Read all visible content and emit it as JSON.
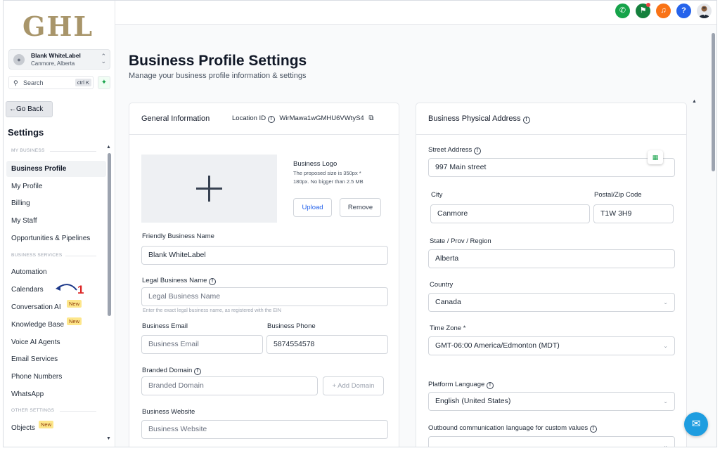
{
  "brand": {
    "logo_text": "GHL",
    "logo_color": "#a8956a"
  },
  "account": {
    "name": "Blank WhiteLabel",
    "location": "Canmore, Alberta"
  },
  "search": {
    "label": "Search",
    "shortcut": "ctrl K"
  },
  "sidebar": {
    "go_back": "Go Back",
    "title": "Settings",
    "sections": [
      {
        "label": "MY BUSINESS"
      },
      {
        "label": "BUSINESS SERVICES"
      },
      {
        "label": "OTHER SETTINGS"
      }
    ],
    "items": [
      {
        "label": "Business Profile",
        "active": true
      },
      {
        "label": "My Profile"
      },
      {
        "label": "Billing"
      },
      {
        "label": "My Staff"
      },
      {
        "label": "Opportunities & Pipelines"
      },
      {
        "label": "Automation"
      },
      {
        "label": "Calendars"
      },
      {
        "label": "Conversation AI",
        "badge": "New"
      },
      {
        "label": "Knowledge Base",
        "badge": "New"
      },
      {
        "label": "Voice AI Agents"
      },
      {
        "label": "Email Services"
      },
      {
        "label": "Phone Numbers"
      },
      {
        "label": "WhatsApp"
      },
      {
        "label": "Objects",
        "badge": "New"
      }
    ],
    "annotation_number": "1"
  },
  "topbar": {
    "icons": [
      "phone-icon",
      "megaphone-icon",
      "bell-icon",
      "help-icon",
      "user-avatar"
    ],
    "colors": {
      "phone": "#16a34a",
      "megaphone": "#15803d",
      "bell": "#f97316",
      "help": "#2563eb"
    },
    "help_label": "?"
  },
  "page": {
    "title": "Business Profile Settings",
    "subtitle": "Manage your business profile information & settings"
  },
  "general": {
    "title": "General Information",
    "location_id_label": "Location ID",
    "location_id_value": "WirMawa1wGMHU6VWtyS4",
    "logo_title": "Business Logo",
    "logo_hint_1": "The proposed size is 350px *",
    "logo_hint_2": "180px. No bigger than 2.5 MB",
    "upload_label": "Upload",
    "remove_label": "Remove",
    "friendly_name_label": "Friendly Business Name",
    "friendly_name_value": "Blank WhiteLabel",
    "legal_name_label": "Legal Business Name",
    "legal_name_placeholder": "Legal Business Name",
    "legal_name_hint": "Enter the exact legal business name, as registered with the EIN",
    "email_label": "Business Email",
    "email_placeholder": "Business Email",
    "phone_label": "Business Phone",
    "phone_value": "5874554578",
    "domain_label": "Branded Domain",
    "domain_placeholder": "Branded Domain",
    "add_domain_label": "+ Add Domain",
    "website_label": "Business Website",
    "website_placeholder": "Business Website"
  },
  "address": {
    "title": "Business Physical Address",
    "street_label": "Street Address",
    "street_value": "997 Main street",
    "city_label": "City",
    "city_value": "Canmore",
    "postal_label": "Postal/Zip Code",
    "postal_value": "T1W 3H9",
    "state_label": "State / Prov / Region",
    "state_value": "Alberta",
    "country_label": "Country",
    "country_value": "Canada",
    "timezone_label": "Time Zone",
    "timezone_required": "*",
    "timezone_value": "GMT-06:00 America/Edmonton (MDT)",
    "language_label": "Platform Language",
    "language_value": "English (United States)",
    "outbound_label": "Outbound communication language for custom values"
  }
}
